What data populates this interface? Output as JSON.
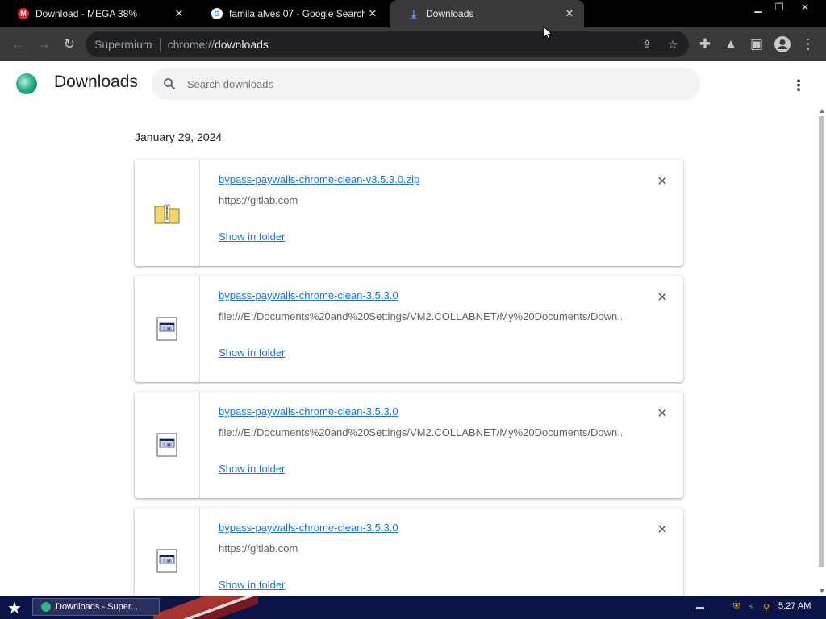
{
  "tabs": [
    {
      "label": "Download - MEGA 38%",
      "favicon": "mega-icon",
      "active": false
    },
    {
      "label": "famila alves 07 - Google Search",
      "favicon": "google-icon",
      "active": false
    },
    {
      "label": "Downloads",
      "favicon": "download-icon",
      "active": true
    }
  ],
  "omnibox": {
    "site_name": "Supermium",
    "url_scheme": "chrome://",
    "url_host": "downloads"
  },
  "page": {
    "title": "Downloads",
    "search_placeholder": "Search downloads"
  },
  "downloads": {
    "date_header": "January 29, 2024",
    "items": [
      {
        "filename": "bypass-paywalls-chrome-clean-v3.5.3.0.zip",
        "source": "https://gitlab.com",
        "action": "Show in folder",
        "icon": "zip-folder-icon"
      },
      {
        "filename": "bypass-paywalls-chrome-clean-3.5.3.0",
        "source": "file:///E:/Documents%20and%20Settings/VM2.COLLABNET/My%20Documents/Down...",
        "action": "Show in folder",
        "icon": "generic-file-icon"
      },
      {
        "filename": "bypass-paywalls-chrome-clean-3.5.3.0",
        "source": "file:///E:/Documents%20and%20Settings/VM2.COLLABNET/My%20Documents/Down...",
        "action": "Show in folder",
        "icon": "generic-file-icon"
      },
      {
        "filename": "bypass-paywalls-chrome-clean-3.5.3.0",
        "source": "https://gitlab.com",
        "action": "Show in folder",
        "icon": "generic-file-icon"
      }
    ]
  },
  "taskbar": {
    "task_label": "Downloads - Super...",
    "clock": "5:27 AM"
  },
  "colors": {
    "link": "#1a73e8",
    "toolbar": "#3a3a3a",
    "titlebar": "#000000",
    "taskbar": "#0a1446"
  }
}
